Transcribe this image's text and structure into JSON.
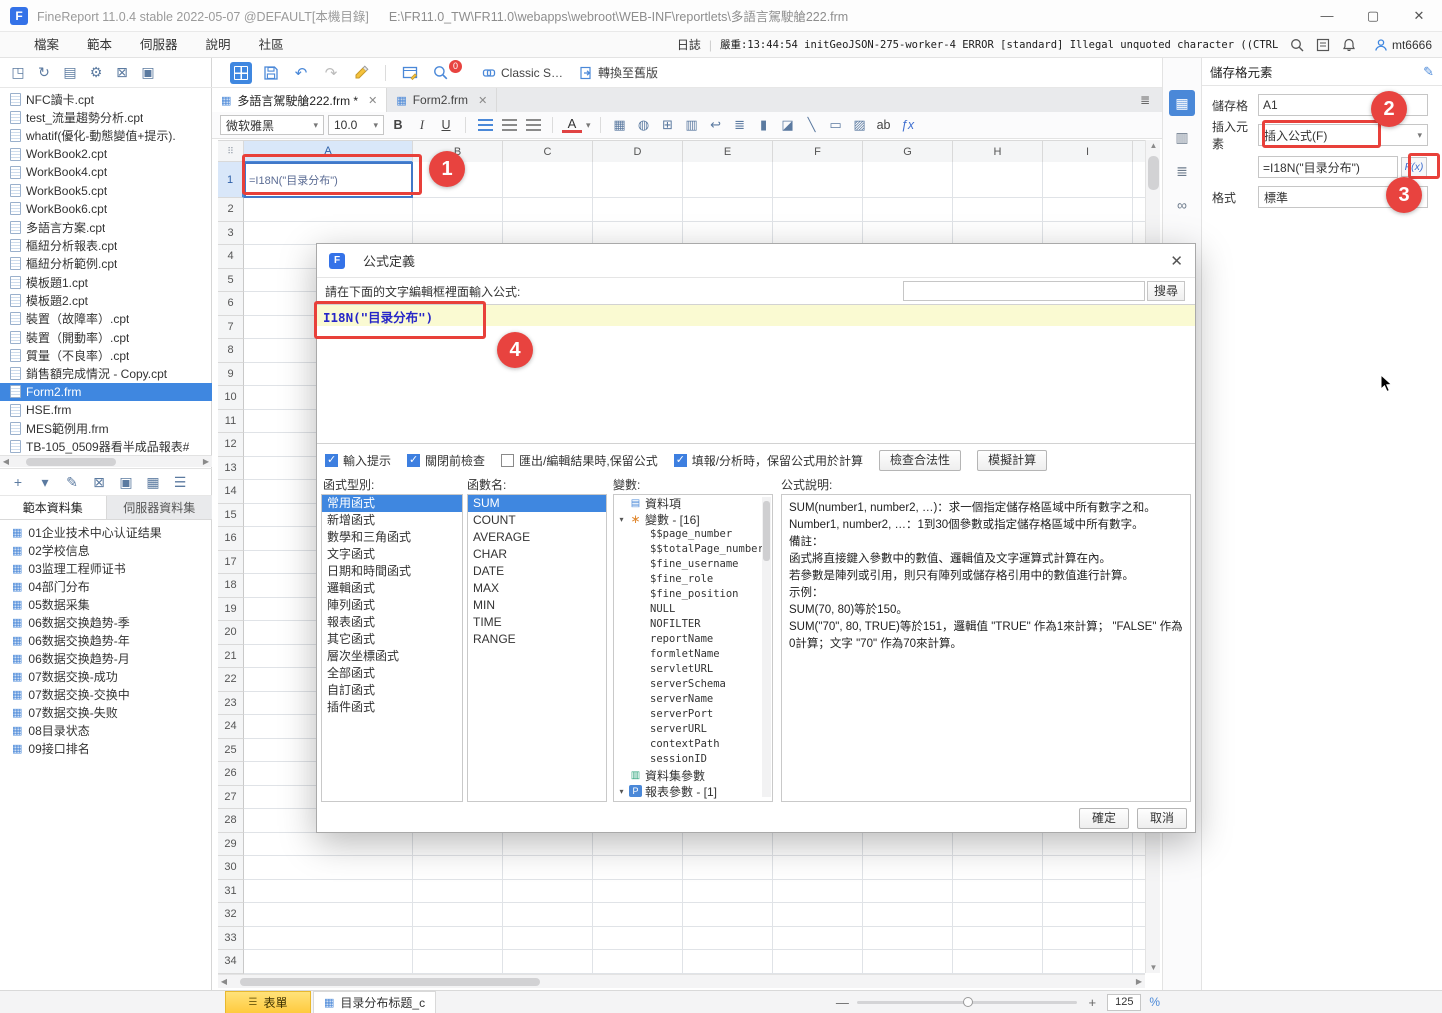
{
  "title_bar": {
    "app_title": "FineReport 11.0.4 stable 2022-05-07 @DEFAULT[本機目錄]",
    "file_path": "E:\\FR11.0_TW\\FR11.0\\webapps\\webroot\\WEB-INF\\reportlets\\多語言駕駛艙222.frm"
  },
  "window_controls": {
    "minimize": "—",
    "maximize": "▢",
    "close": "✕"
  },
  "menu_bar": {
    "items": [
      "檔案",
      "範本",
      "伺服器",
      "說明",
      "社區"
    ],
    "log_label": "日誌",
    "log_separator": "|",
    "log_message": "嚴重:13:44:54 initGeoJSON-275-worker-4 ERROR [standard] Illegal unquoted character ((CTRL-…",
    "user_name": "mt6666"
  },
  "left_toolbar": [
    {
      "name": "new-template-icon",
      "glyph": "◳"
    },
    {
      "name": "refresh-icon",
      "glyph": "↻"
    },
    {
      "name": "folder-view-icon",
      "glyph": "▤"
    },
    {
      "name": "settings-icon",
      "glyph": "⚙"
    },
    {
      "name": "delete-icon",
      "glyph": "⊠"
    },
    {
      "name": "copy-icon",
      "glyph": "▣"
    }
  ],
  "main_toolbar": {
    "undo": "↶",
    "redo": "↷",
    "preview_badge": "0",
    "classic_label": "Classic S…",
    "convert_label": "轉換至舊版"
  },
  "template_tabs": [
    {
      "label": "多語言駕駛艙222.frm *",
      "active": true
    },
    {
      "label": "Form2.frm",
      "active": false
    }
  ],
  "format_toolbar": {
    "font_family": "微软雅黑",
    "font_size": "10.0",
    "bold": "B",
    "italic": "I",
    "underline": "U",
    "ab": "ab",
    "fx": "ƒx"
  },
  "format_icons": [
    {
      "name": "merge-cell-icon",
      "glyph": "▦"
    },
    {
      "name": "fill-color-icon",
      "glyph": "◍"
    },
    {
      "name": "border-icon",
      "glyph": "⊞"
    },
    {
      "name": "cell-style-icon",
      "glyph": "▥"
    },
    {
      "name": "wrap-text-icon",
      "glyph": "↩"
    },
    {
      "name": "list-icon",
      "glyph": "≣"
    },
    {
      "name": "chart-insert-icon",
      "glyph": "▮"
    },
    {
      "name": "image-insert-icon",
      "glyph": "◪"
    },
    {
      "name": "line-insert-icon",
      "glyph": "╲"
    },
    {
      "name": "widget-insert-icon",
      "glyph": "▭"
    },
    {
      "name": "condition-icon",
      "glyph": "▨"
    }
  ],
  "sidebar": {
    "files": [
      "NFC讀卡.cpt",
      "test_流量趨勢分析.cpt",
      "whatif(優化-動態變值+提示).",
      "WorkBook2.cpt",
      "WorkBook4.cpt",
      "WorkBook5.cpt",
      "WorkBook6.cpt",
      "多語言方案.cpt",
      "樞紐分析報表.cpt",
      "樞紐分析範例.cpt",
      "模板題1.cpt",
      "模板題2.cpt",
      "裝置（故障率）.cpt",
      "裝置（開動率）.cpt",
      "質量（不良率）.cpt",
      "銷售額完成情況 - Copy.cpt",
      "Form2.frm",
      "HSE.frm",
      "MES範例用.frm",
      "TB-105_0509器看半成品報表#"
    ],
    "selected_file": "Form2.frm",
    "dataset_tabs": [
      "範本資料集",
      "伺服器資料集"
    ],
    "active_dataset_tab": "範本資料集",
    "datasets": [
      "01企业技术中心认证结果",
      "02学校信息",
      "03监理工程师证书",
      "04部门分布",
      "05数据采集",
      "06数据交换趋势-季",
      "06数据交换趋势-年",
      "06数据交换趋势-月",
      "07数据交换-成功",
      "07数据交换-交换中",
      "07数据交换-失败",
      "08目录状态",
      "09接口排名"
    ]
  },
  "ds_toolbar": [
    {
      "name": "add-dataset-icon",
      "glyph": "+"
    },
    {
      "name": "add-dataset-caret-icon",
      "glyph": "▾"
    },
    {
      "name": "edit-dataset-icon",
      "glyph": "✎"
    },
    {
      "name": "delete-dataset-icon",
      "glyph": "⊠"
    },
    {
      "name": "copy-dataset-icon",
      "glyph": "▣"
    },
    {
      "name": "preview-dataset-icon",
      "glyph": "▦"
    },
    {
      "name": "sort-dataset-icon",
      "glyph": "☰"
    }
  ],
  "spreadsheet": {
    "columns": [
      "A",
      "B",
      "C",
      "D",
      "E",
      "F",
      "G",
      "H",
      "I"
    ],
    "row_count": 34,
    "selected_cell": "A1",
    "a1_formula": "=I18N(\"目录分布\")"
  },
  "right_strip": [
    {
      "name": "cell-element-icon",
      "glyph": "▦",
      "active": true
    },
    {
      "name": "cell-attribute-icon",
      "glyph": "▥",
      "active": false
    },
    {
      "name": "component-hierarchy-icon",
      "glyph": "≣",
      "active": false
    },
    {
      "name": "hyperlink-icon",
      "glyph": "∞",
      "active": false
    }
  ],
  "cell_panel": {
    "title": "儲存格元素",
    "cell_label": "儲存格",
    "cell_ref": "A1",
    "insert_label": "插入元素",
    "insert_value": "插入公式(F)",
    "formula_value": "=I18N(\"目录分布\")",
    "fx_button": "F(x)",
    "format_label": "格式",
    "format_value": "標準"
  },
  "formula_dialog": {
    "title": "公式定義",
    "prompt": "請在下面的文字編輯框裡面輸入公式:",
    "search_button": "搜尋",
    "formula_text": "I18N(\"目录分布\")",
    "options": [
      {
        "label": "輸入提示",
        "checked": true
      },
      {
        "label": "關閉前檢查",
        "checked": true
      },
      {
        "label": "匯出/編輯結果時,保留公式",
        "checked": false
      },
      {
        "label": "填報/分析時，保留公式用於計算",
        "checked": true
      }
    ],
    "check_button": "檢查合法性",
    "simulate_button": "模擬計算",
    "category_label": "函式型別:",
    "categories": [
      "常用函式",
      "新增函式",
      "數學和三角函式",
      "文字函式",
      "日期和時間函式",
      "邏輯函式",
      "陣列函式",
      "報表函式",
      "其它函式",
      "層次坐標函式",
      "全部函式",
      "自訂函式",
      "插件函式"
    ],
    "selected_category": "常用函式",
    "fn_label": "函數名:",
    "functions": [
      "SUM",
      "COUNT",
      "AVERAGE",
      "CHAR",
      "DATE",
      "MAX",
      "MIN",
      "TIME",
      "RANGE"
    ],
    "selected_function": "SUM",
    "vars_label": "變數:",
    "var_groups": [
      {
        "label": "資料項",
        "icon": "data-item-icon",
        "glyph": "▤",
        "caret": "",
        "children": []
      },
      {
        "label": "變數 - [16]",
        "icon": "variable-icon",
        "glyph": "∗",
        "caret": "▾",
        "children": [
          "$$page_number",
          "$$totalPage_number",
          "$fine_username",
          "$fine_role",
          "$fine_position",
          "NULL",
          "NOFILTER",
          "reportName",
          "formletName",
          "servletURL",
          "serverSchema",
          "serverName",
          "serverPort",
          "serverURL",
          "contextPath",
          "sessionID"
        ]
      },
      {
        "label": "資料集參數",
        "icon": "dataset-param-icon",
        "glyph": "▥",
        "caret": "",
        "children": []
      },
      {
        "label": "報表參數 - [1]",
        "icon": "report-param-icon",
        "glyph": "P",
        "caret": "▾",
        "children": []
      }
    ],
    "desc_label": "公式說明:",
    "description_lines": [
      "SUM(number1, number2, …)：求一個指定儲存格區域中所有數字之和。",
      "Number1, number2, …：1到30個參數或指定儲存格區域中所有數字。",
      "備註：",
      "函式將直接鍵入參數中的數值、邏輯值及文字運算式計算在內。",
      "若參數是陣列或引用，則只有陣列或儲存格引用中的數值進行計算。",
      "示例：",
      "SUM(70, 80)等於150。",
      "SUM(\"70\", 80, TRUE)等於151，邏輯值 \"TRUE\" 作為1來計算； \"FALSE\" 作為0計算；文字 \"70\" 作為70來計算。"
    ],
    "ok_button": "確定",
    "cancel_button": "取消"
  },
  "bottom_bar": {
    "sheet_tab": "表單",
    "component_tab": "目录分布标题_c",
    "zoom_value": "125"
  },
  "annotations": {
    "badges": [
      "1",
      "2",
      "3",
      "4"
    ]
  },
  "icons": {
    "chevron_down": "▾",
    "grid": "▦",
    "bars": "☰",
    "corner": "⠿",
    "up": "▲",
    "down": "▼",
    "left": "◀",
    "right": "▶",
    "minus": "—",
    "plus": "+",
    "percent": "%",
    "pencil": "✎",
    "tab_list": "≣"
  }
}
